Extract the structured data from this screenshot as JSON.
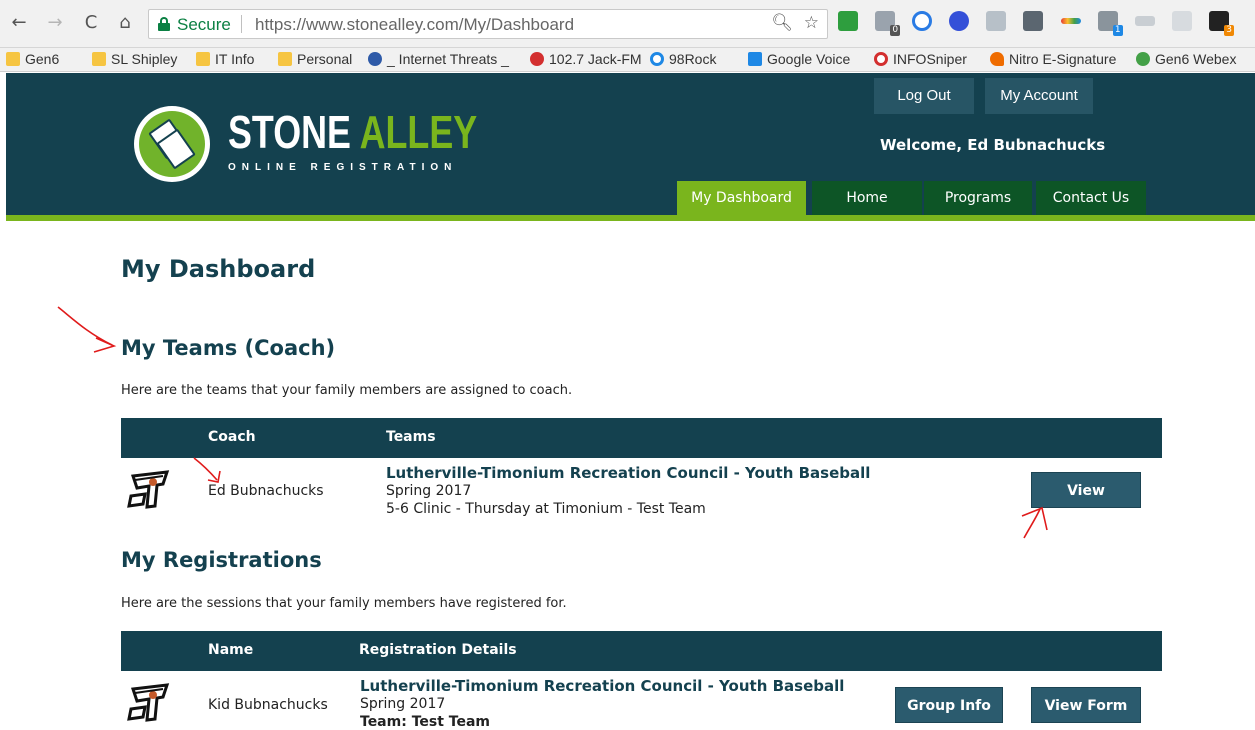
{
  "browser": {
    "nav": {
      "back": "←",
      "forward": "→",
      "reload": "C",
      "home": "⌂"
    },
    "secure_label": "Secure",
    "url": "https://www.stonealley.com/My/Dashboard",
    "omni_icons": [
      "zoom-icon",
      "star-icon"
    ],
    "bookmarks": [
      {
        "label": "Gen6",
        "icon": "folder-icon"
      },
      {
        "label": "SL Shipley",
        "icon": "folder-icon"
      },
      {
        "label": "IT Info",
        "icon": "folder-icon"
      },
      {
        "label": "Personal",
        "icon": "folder-icon"
      },
      {
        "label": "_ Internet Threats _",
        "icon": "globe-icon"
      },
      {
        "label": "102.7 Jack-FM",
        "icon": "radio-icon"
      },
      {
        "label": "98Rock",
        "icon": "circle-arrows-icon"
      },
      {
        "label": "Google Voice",
        "icon": "phone-icon"
      },
      {
        "label": "INFOSniper",
        "icon": "target-icon"
      },
      {
        "label": "Nitro E-Signature",
        "icon": "flame-icon"
      },
      {
        "label": "Gen6 Webex",
        "icon": "webex-icon"
      }
    ],
    "extensions": [
      {
        "name": "extension-green-icon",
        "badge": ""
      },
      {
        "name": "extension-puzzle-icon",
        "badge": "0"
      },
      {
        "name": "extension-skype-icon",
        "badge": ""
      },
      {
        "name": "extension-v-icon",
        "badge": ""
      },
      {
        "name": "extension-tag-icon",
        "badge": ""
      },
      {
        "name": "extension-bag-icon",
        "badge": ""
      },
      {
        "name": "extension-chevron-icon",
        "badge": ""
      },
      {
        "name": "extension-grid-icon",
        "badge": "1"
      },
      {
        "name": "extension-key-icon",
        "badge": ""
      },
      {
        "name": "extension-g-icon",
        "badge": ""
      },
      {
        "name": "extension-amazon-icon",
        "badge": "3"
      }
    ]
  },
  "site": {
    "logo": {
      "title_stone": "STONE",
      "title_alley": "ALLEY",
      "subtitle": "ONLINE REGISTRATION"
    },
    "top_nav": {
      "logout": "Log Out",
      "my_account": "My Account"
    },
    "welcome": "Welcome, Ed Bubnachucks",
    "main_nav": [
      {
        "label": "My Dashboard",
        "active": true
      },
      {
        "label": "Home",
        "active": false
      },
      {
        "label": "Programs",
        "active": false
      },
      {
        "label": "Contact Us",
        "active": false
      }
    ],
    "colors": {
      "primary": "#14414f",
      "accent": "#7ab51d",
      "nav_bg": "#0d5526",
      "button": "#2b5b6e"
    }
  },
  "dashboard": {
    "title": "My Dashboard",
    "teams": {
      "heading": "My Teams (Coach)",
      "intro": "Here are the teams that your family members are assigned to coach.",
      "columns": [
        "Coach",
        "Teams"
      ],
      "rows": [
        {
          "coach": "Ed Bubnachucks",
          "org": "Lutherville-Timonium Recreation Council - Youth Baseball",
          "season": "Spring 2017",
          "team": "5-6 Clinic - Thursday at Timonium - Test Team",
          "action": "View"
        }
      ]
    },
    "registrations": {
      "heading": "My Registrations",
      "intro": "Here are the sessions that your family members have registered for.",
      "columns": [
        "Name",
        "Registration Details"
      ],
      "rows": [
        {
          "name": "Kid Bubnachucks",
          "org": "Lutherville-Timonium Recreation Council - Youth Baseball",
          "season": "Spring 2017",
          "team": "Team: Test Team",
          "actions": [
            "Group Info",
            "View Form"
          ]
        }
      ]
    }
  }
}
